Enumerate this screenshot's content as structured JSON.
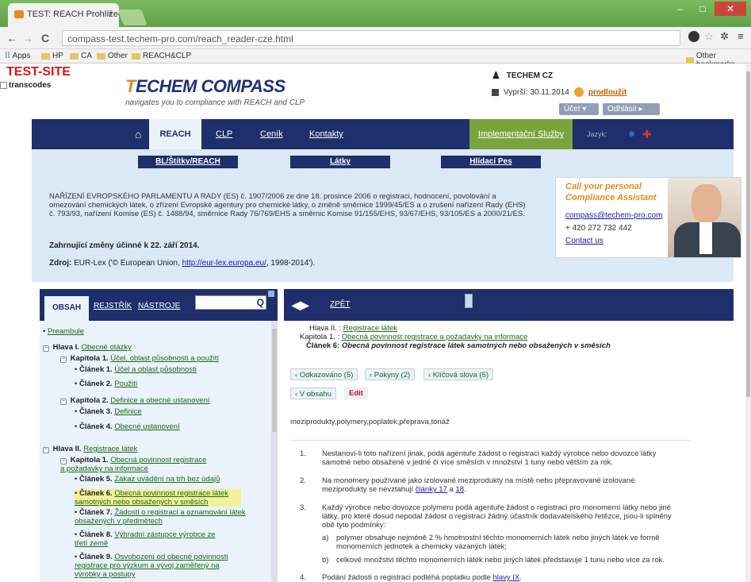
{
  "browser": {
    "tab_title": "TEST: REACH Prohlížeč Ze",
    "tab_close": "×",
    "url": "compass-test.techem-pro.com/reach_reader-cze.html",
    "back": "←",
    "forward": "→",
    "reload": "C",
    "bookmarks": [
      "Apps",
      "HP",
      "CA",
      "Other",
      "REACH&CLP"
    ],
    "other_bookmarks": "Other bookmarks",
    "win_min": "–",
    "win_max": "□",
    "win_close": "✕"
  },
  "header": {
    "test_site": "TEST-SITE",
    "transcodes": "transcodes",
    "logo_t": "T",
    "logo_rest": "ECHEM COMPASS",
    "tagline": "navigates you to compliance with REACH and CLP",
    "user": "TECHEM CZ",
    "expiry": "Vyprší: 30.11.2014",
    "prodlouzit": "prodloužit",
    "ucet": "Účet ▾",
    "odhlasit": "Odhlásit ▸"
  },
  "nav": {
    "home_icon": "⌂",
    "reach": "REACH",
    "clp": "CLP",
    "cenik": "Ceník",
    "kontakty": "Kontakty",
    "implementacni": "Implementační Služby",
    "jazyk": "Jazyk:",
    "lang_cz": "●",
    "lang_uk": "✚"
  },
  "banner": {
    "btn1": "BL/Štítky/REACH",
    "btn2": "Látky",
    "btn3": "Hlídací Pes",
    "regulation": "NAŘÍZENÍ EVROPSKÉHO PARLAMENTU A RADY (ES) č. 1907/2006 ze dne 18. prosince 2006 o registraci, hodnocení, povolování a omezování chemických látek, o zřízení Evropské agentury pro chemické látky, o změně směrnice 1999/45/ES a o zrušení nařízení Rady (EHS) č. 793/93, nařízení Komise (ES) č. 1488/94, směrnice Rady 76/769/EHS a směrnic Komise 91/155/EHS, 93/67/EHS, 93/105/ES a 2000/21/ES.",
    "changes": "Zahrnující změny účinné k 22. září 2014.",
    "source_label": "Zdroj:",
    "source_pre": " EUR-Lex ('© European Union, ",
    "source_link": "http://eur-lex.europa.eu/",
    "source_post": ", 1998-2014').",
    "call_line1": "Call your personal",
    "call_line2": "Compliance Assistant",
    "email": "compass@techem-pro.com",
    "phone": "+ 420 272 732 442",
    "contact": "Contact us"
  },
  "left_panel": {
    "tab_obsah": "OBSAH",
    "tab_rejstrik": "REJSTŘÍK",
    "tab_nastroje": "NÁSTROJE",
    "search_icon": "Q",
    "tree": [
      {
        "prefix": "• ",
        "bold": "",
        "link": "Preambule",
        "cls": ""
      },
      {
        "prefix": "−",
        "bold": " Hlava I. ",
        "link": "Obecné otázky",
        "cls": ""
      },
      {
        "prefix": "−",
        "bold": " Kapitola 1. ",
        "link": "Účel, oblast působnosti a použití",
        "cls": ""
      },
      {
        "prefix": "• ",
        "bold": "Článek 1. ",
        "link": "Účel a oblast působnosti",
        "cls": ""
      },
      {
        "prefix": "• ",
        "bold": "Článek 2. ",
        "link": "Použití",
        "cls": ""
      },
      {
        "prefix": "−",
        "bold": " Kapitola 2. ",
        "link": "Definice a obecné ustanovení",
        "cls": ""
      },
      {
        "prefix": "• ",
        "bold": "Článek 3. ",
        "link": "Definice",
        "cls": ""
      },
      {
        "prefix": "• ",
        "bold": "Článek 4. ",
        "link": "Obecné ustanovení",
        "cls": ""
      },
      {
        "prefix": "−",
        "bold": " Hlava II. ",
        "link": "Registrace látek",
        "cls": ""
      },
      {
        "prefix": "−",
        "bold": " Kapitola 1. ",
        "link": "Obecná povinnost registrace a požadavky na informace",
        "cls": ""
      },
      {
        "prefix": "• ",
        "bold": "Článek 5. ",
        "link": "Zákaz uvádění na trh bez údajů",
        "cls": ""
      },
      {
        "prefix": "• ",
        "bold": "Článek 6. ",
        "link": "Obecná povinnost registrace látek samotných nebo obsažených v směsích",
        "cls": "sel"
      },
      {
        "prefix": "• ",
        "bold": "Článek 7. ",
        "link": "Žádosti o registraci a oznamování látek obsažených v předmětech",
        "cls": ""
      },
      {
        "prefix": "• ",
        "bold": "Článek 8. ",
        "link": "Výhradní zástupce výrobce ze třetí země",
        "cls": ""
      },
      {
        "prefix": "• ",
        "bold": "Článek 9. ",
        "link": "Osvobození od obecné povinnosti registrace pro výzkum a vývoj zaměřený na výrobky a postupy",
        "cls": ""
      }
    ]
  },
  "right_panel": {
    "arrows": "◀▶",
    "zpet": "ZPĚT",
    "hlava_label": "Hlava II. : ",
    "hlava_link": "Registrace látek",
    "kapitola_label": "Kapitola 1. : ",
    "kapitola_link": "Obecná povinnost registrace a požadavky na informace",
    "clanek_label": "Článek 6: ",
    "clanek_title": "Obecná povinnost registrace látek samotných nebo obsažených v směsích",
    "btn_odkazovano": "‹ Odkazováno (5)",
    "btn_pokyny": "‹ Pokyny (2)",
    "btn_klicova": "‹ Klíčová slova (5)",
    "btn_vobsahu": "‹ V obsahu",
    "btn_edit": "Edit",
    "keywords": "meziprodukty,polymery,poplatek,přeprava,tonáž",
    "items": [
      {
        "n": "1.",
        "text": "Nestanoví-li toto nařízení jinak, podá agentuře žádost o registraci každý výrobce nebo dovozce látky samotné nebo obsažené v jedné či více směsích v množství 1 tuny nebo větším za rok."
      },
      {
        "n": "2.",
        "text_pre": "Na monomery používané jako izolované meziprodukty na místě nebo přepravované izolované meziprodukty se nevztahují ",
        "link1": "články 17",
        "mid": " a ",
        "link2": "18",
        "post": "."
      },
      {
        "n": "3.",
        "text": "Každý výrobce nebo dovozce polymeru podá agentuře žádost o registraci pro monomerní látky nebo jiné látky, pro které dosud nepodal žádost o registraci žádný účastník dodavatelského řetězce, jsou-li splněny obě tyto podmínky:"
      },
      {
        "n": "a)",
        "text": "polymer obsahuje nejméně 2 % hmotnostní těchto monomerních látek nebo jiných látek ve formě monomerních jednotek a chemicky vázaných látek;"
      },
      {
        "n": "b)",
        "text": "celkové množství těchto monomerních látek nebo jiných látek představuje 1 tunu nebo více za rok."
      },
      {
        "n": "4.",
        "text_pre": "Podání žádosti o registraci podléhá poplatku podle ",
        "link1": "hlavy IX",
        "post": "."
      }
    ]
  }
}
